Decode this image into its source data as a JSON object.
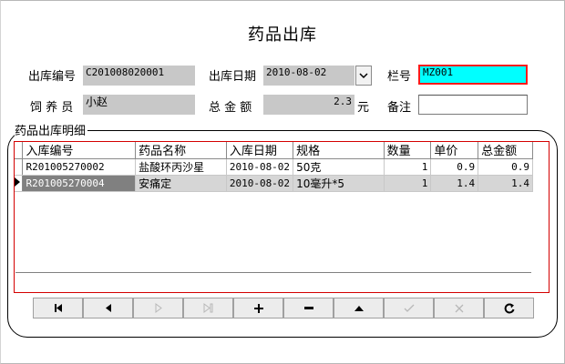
{
  "form": {
    "title": "药品出库",
    "outbound_no_label": "出库编号",
    "outbound_no_value": "C201008020001",
    "outbound_date_label": "出库日期",
    "outbound_date_value": "2010-08-02",
    "pen_label": "栏号",
    "pen_value": "MZ001",
    "keeper_label": "饲 养 员",
    "keeper_value": "小赵",
    "total_label": "总 金 额",
    "total_value": "2.3",
    "currency_label": "元",
    "remark_label": "备注",
    "remark_value": ""
  },
  "details": {
    "group_label": "药品出库明细",
    "columns": [
      "入库编号",
      "药品名称",
      "入库日期",
      "规格",
      "数量",
      "单价",
      "总金额"
    ],
    "rows": [
      [
        "R201005270002",
        "盐酸环丙沙星",
        "2010-08-02",
        "50克",
        "1",
        "0.9",
        "0.9"
      ],
      [
        "R201005270004",
        "安痛定",
        "2010-08-02",
        "10毫升*5",
        "1",
        "1.4",
        "1.4"
      ]
    ],
    "selected_row": 1
  },
  "navigator": {
    "buttons": [
      {
        "name": "first-record",
        "icon": "first-icon",
        "enabled": true
      },
      {
        "name": "prior-record",
        "icon": "prior-icon",
        "enabled": true
      },
      {
        "name": "next-record",
        "icon": "next-icon",
        "enabled": false
      },
      {
        "name": "last-record",
        "icon": "last-icon",
        "enabled": false
      },
      {
        "name": "insert-record",
        "icon": "plus-icon",
        "enabled": true
      },
      {
        "name": "delete-record",
        "icon": "minus-icon",
        "enabled": true
      },
      {
        "name": "edit-record",
        "icon": "up-triangle-icon",
        "enabled": true
      },
      {
        "name": "post-record",
        "icon": "check-icon",
        "enabled": false
      },
      {
        "name": "cancel-record",
        "icon": "cross-icon",
        "enabled": false
      },
      {
        "name": "refresh-record",
        "icon": "refresh-icon",
        "enabled": true
      }
    ]
  },
  "colors": {
    "readonly_field": "#c8c8c8",
    "highlight_field": "#00ffff",
    "highlight_border": "#ff1a1a",
    "grid_frame": "#d40000"
  }
}
